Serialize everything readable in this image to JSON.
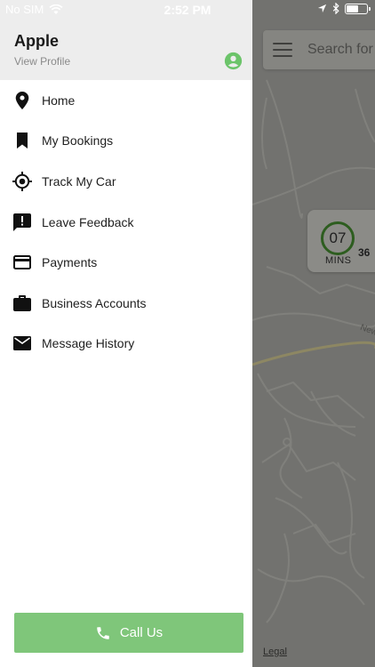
{
  "status_bar": {
    "carrier": "No SIM",
    "time": "2:52 PM"
  },
  "profile": {
    "name": "Apple",
    "link": "View Profile"
  },
  "menu": {
    "items": [
      {
        "label": "Home",
        "icon": "location-pin-icon"
      },
      {
        "label": "My Bookings",
        "icon": "bookmark-icon"
      },
      {
        "label": "Track My Car",
        "icon": "gps-crosshair-icon"
      },
      {
        "label": "Leave Feedback",
        "icon": "feedback-icon"
      },
      {
        "label": "Payments",
        "icon": "credit-card-icon"
      },
      {
        "label": "Business Accounts",
        "icon": "briefcase-icon"
      },
      {
        "label": "Message History",
        "icon": "envelope-icon"
      }
    ]
  },
  "call_button": {
    "label": "Call Us"
  },
  "map": {
    "search_placeholder": "Search for p",
    "eta": {
      "minutes": "07",
      "unit": "MINS",
      "side_value": "36"
    },
    "street_label": "New",
    "legal": "Legal"
  },
  "colors": {
    "accent_green": "#7fc67a",
    "profile_icon_green": "#6cc46a",
    "drawer_header": "#ededed"
  }
}
